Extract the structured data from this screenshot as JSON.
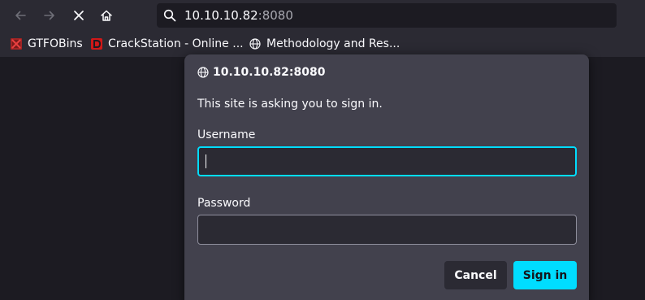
{
  "toolbar": {
    "url_host": "10.10.10.82",
    "url_port": ":8080"
  },
  "bookmarks": [
    {
      "label": "GTFOBins",
      "icon": "gtfobins-favicon"
    },
    {
      "label": "CrackStation - Online ...",
      "icon": "crackstation-favicon"
    },
    {
      "label": "Methodology and Res...",
      "icon": "globe-icon"
    }
  ],
  "dialog": {
    "title": "10.10.10.82:8080",
    "message": "This site is asking you to sign in.",
    "username_label": "Username",
    "username_value": "",
    "password_label": "Password",
    "password_value": "",
    "cancel_label": "Cancel",
    "signin_label": "Sign in"
  },
  "colors": {
    "accent": "#00ddff",
    "toolbar": "#2b2a33",
    "dialog": "#42414d",
    "page": "#1c1b22"
  }
}
